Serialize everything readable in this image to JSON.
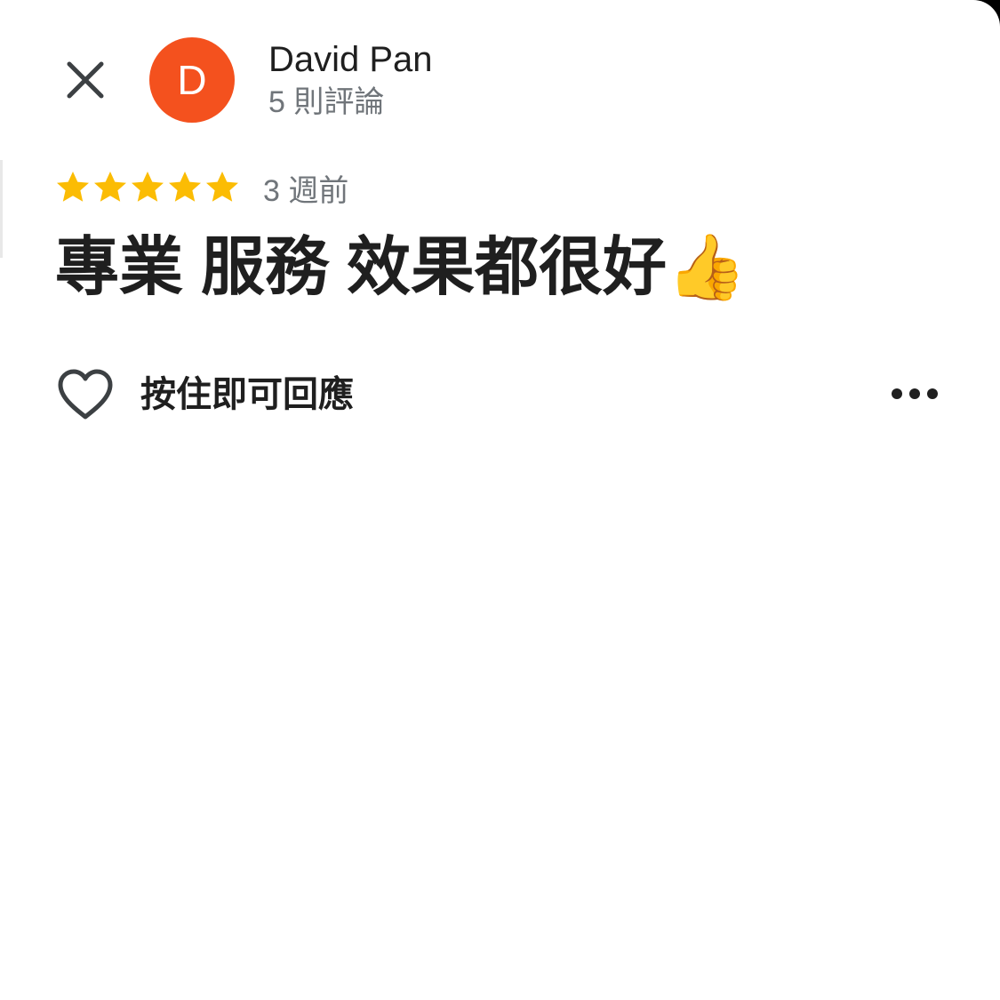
{
  "header": {
    "close_icon": "close-icon",
    "avatar_letter": "D",
    "avatar_color": "#f4511e",
    "author_name": "David Pan",
    "review_count": "5 則評論"
  },
  "review": {
    "rating": 5,
    "rating_max": 5,
    "star_color": "#fbbc04",
    "time_ago": "3 週前",
    "text": "專業 服務 效果都很好👍"
  },
  "actions": {
    "like_icon": "heart-outline-icon",
    "reply_hint": "按住即可回應",
    "more_icon": "more-horizontal-icon"
  }
}
